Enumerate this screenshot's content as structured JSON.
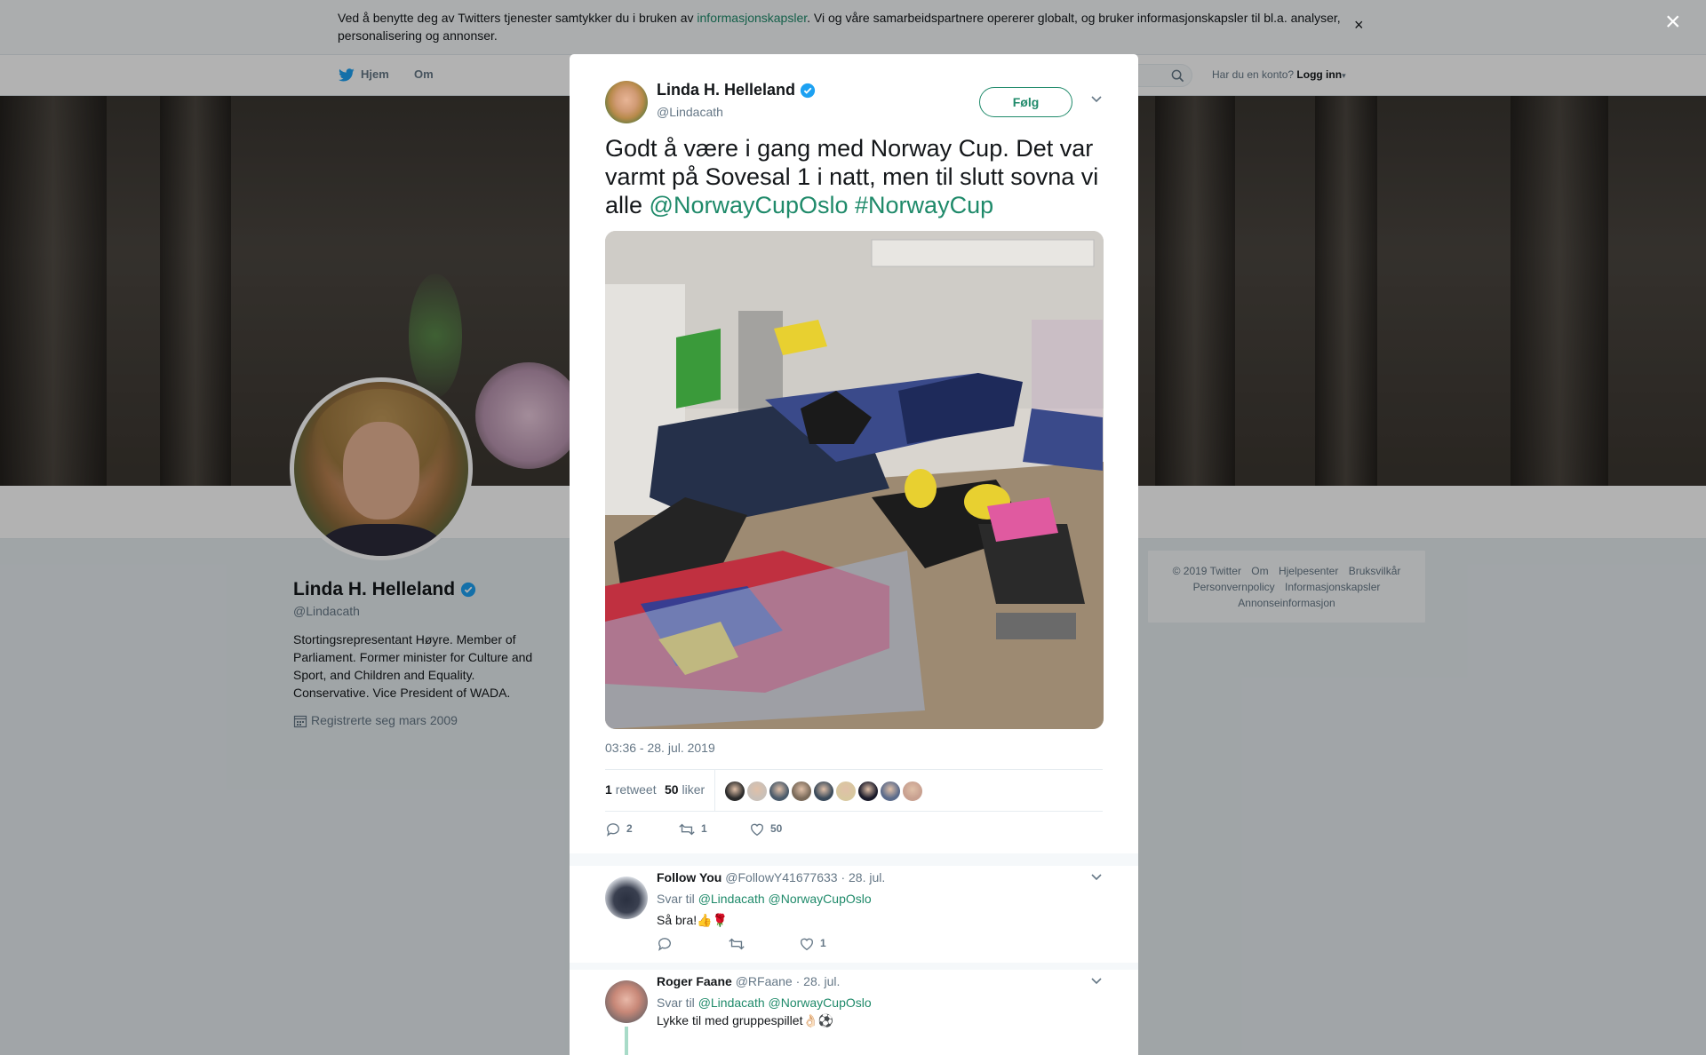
{
  "cookie": {
    "text_before": "Ved å benytte deg av Twitters tjenester samtykker du i bruken av ",
    "link": "informasjonskapsler",
    "text_after": ". Vi og våre samarbeidspartnere opererer globalt, og bruker informasjonskapsler til bl.a. analyser, personalisering og annonser.",
    "close": "×"
  },
  "nav": {
    "home": "Hjem",
    "about": "Om",
    "account_prompt": "Har du en konto?",
    "login": "Logg inn"
  },
  "profile": {
    "name": "Linda H. Helleland",
    "handle": "@Lindacath",
    "bio": "Stortingsrepresentant Høyre. Member of Parliament. Former minister for Culture and Sport, and Children and Equality. Conservative. Vice President of WADA.",
    "joined": "Registrerte seg mars 2009"
  },
  "footer": {
    "row1": [
      "© 2019 Twitter",
      "Om",
      "Hjelpesenter",
      "Bruksvilkår"
    ],
    "row2": [
      "Personvernpolicy",
      "Informasjonskapsler"
    ],
    "row3": [
      "Annonseinformasjon"
    ]
  },
  "overlay_close": "×",
  "tweet": {
    "name": "Linda H. Helleland",
    "handle": "@Lindacath",
    "follow_label": "Følg",
    "text": "Godt å være i gang med Norway Cup. Det var varmt på Sovesal 1 i natt, men til slutt sovna vi alle ",
    "mention": "@NorwayCupOslo",
    "hashtag": "#NorwayCup",
    "timestamp": "03:36 - 28. jul. 2019",
    "retweets_count": "1",
    "retweets_label": "retweet",
    "likes_count": "50",
    "likes_label": "liker",
    "reply_count": "2",
    "retweet_count_action": "1",
    "like_count_action": "50",
    "liker_colors": [
      "#2a2a2a",
      "#c9c0b8",
      "#4a5a6a",
      "#7a6a5a",
      "#3a4a5a",
      "#d8c8a0",
      "#1a1a2a",
      "#5a6a8a",
      "#c8a090"
    ]
  },
  "replies": [
    {
      "name": "Follow You",
      "handle": "@FollowY41677633",
      "date": "· 28. jul.",
      "reply_to_label": "Svar til",
      "reply_to_1": "@Lindacath",
      "reply_to_2": "@NorwayCupOslo",
      "text": "Så bra!👍🌹",
      "likes": "1",
      "avatar_color": "#3a4050"
    },
    {
      "name": "Roger Faane",
      "handle": "@RFaane",
      "date": "· 28. jul.",
      "reply_to_label": "Svar til",
      "reply_to_1": "@Lindacath",
      "reply_to_2": "@NorwayCupOslo",
      "text": "Lykke til med gruppespillet👌🏻⚽",
      "avatar_color": "#b07060"
    }
  ]
}
